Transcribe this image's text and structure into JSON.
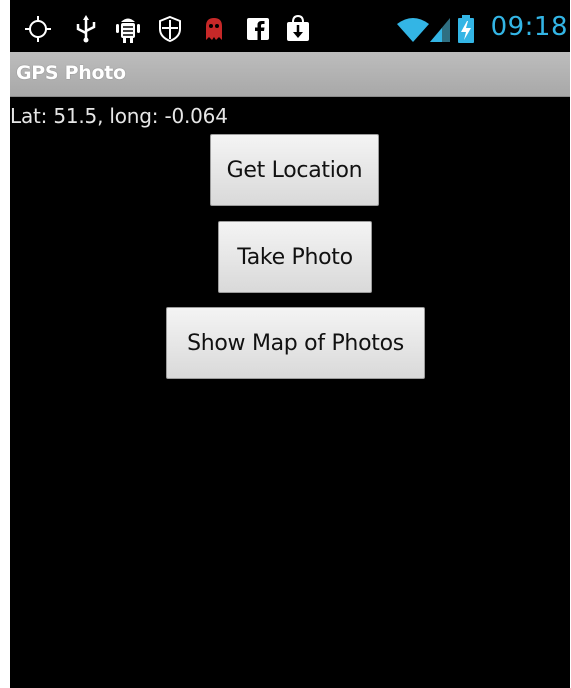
{
  "status_bar": {
    "time": "09:18",
    "icons": [
      "gps-icon",
      "usb-icon",
      "android-debug-icon",
      "shield-icon",
      "ghost-icon",
      "facebook-icon",
      "download-icon",
      "wifi-icon",
      "signal-icon",
      "battery-charging-icon"
    ],
    "time_color": "#33b5e5"
  },
  "action_bar": {
    "title": "GPS Photo"
  },
  "main": {
    "location_text": "Lat: 51.5, long: -0.064",
    "buttons": {
      "get_location": "Get Location",
      "take_photo": "Take Photo",
      "show_map": "Show Map of Photos"
    }
  },
  "colors": {
    "background": "#000000",
    "action_bar": "#b3b3b3",
    "button_face": "#e6e6e6"
  }
}
